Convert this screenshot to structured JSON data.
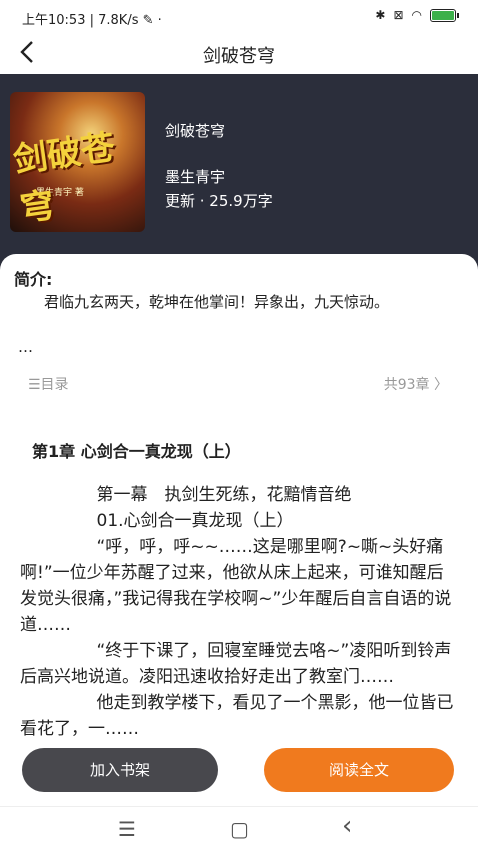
{
  "status": {
    "time": "上午10:53",
    "speed": "7.8K/s",
    "battery_percent": "100",
    "battery_level": 1.0,
    "battery_color": "#3cb04a"
  },
  "titlebar": {
    "back_icon": "chevron-left-icon",
    "title": "剑破苍穹"
  },
  "book": {
    "cover_title": "剑破苍穹",
    "cover_subtitle": "墨生青宇 著",
    "title": "剑破苍穹",
    "author": "墨生青宇",
    "info": "更新 · 25.9万字"
  },
  "intro": {
    "label": "简介:",
    "text": "君临九玄两天，乾坤在他掌间！异象出，九天惊动。",
    "ellipsis": "…"
  },
  "catalog": {
    "toc_label": "☰目录",
    "count_label": "共93章 〉"
  },
  "chapter": {
    "title": "第1章 心剑合一真龙现（上）",
    "paragraphs": [
      "第一幕　执剑生死练，花黯情音绝",
      "01.心剑合一真龙现（上）",
      "“呼，呼，呼~~……这是哪里啊?~嘶~头好痛啊!”一位少年苏醒了过来，他欲从床上起来，可谁知醒后发觉头很痛，”我记得我在学校啊~”少年醒后自言自语的说道……",
      "“终于下课了，回寝室睡觉去咯~”凌阳听到铃声后高兴地说道。凌阳迅速收拾好走出了教室门……",
      "他走到教学楼下，看见了一个黑影，他一位皆已看花了，一……"
    ]
  },
  "actions": {
    "shelf": "加入书架",
    "read": "阅读全文",
    "accent": "#f07a1e"
  },
  "navbar": {
    "menu": "☰",
    "home": "▢",
    "back": "‹"
  }
}
